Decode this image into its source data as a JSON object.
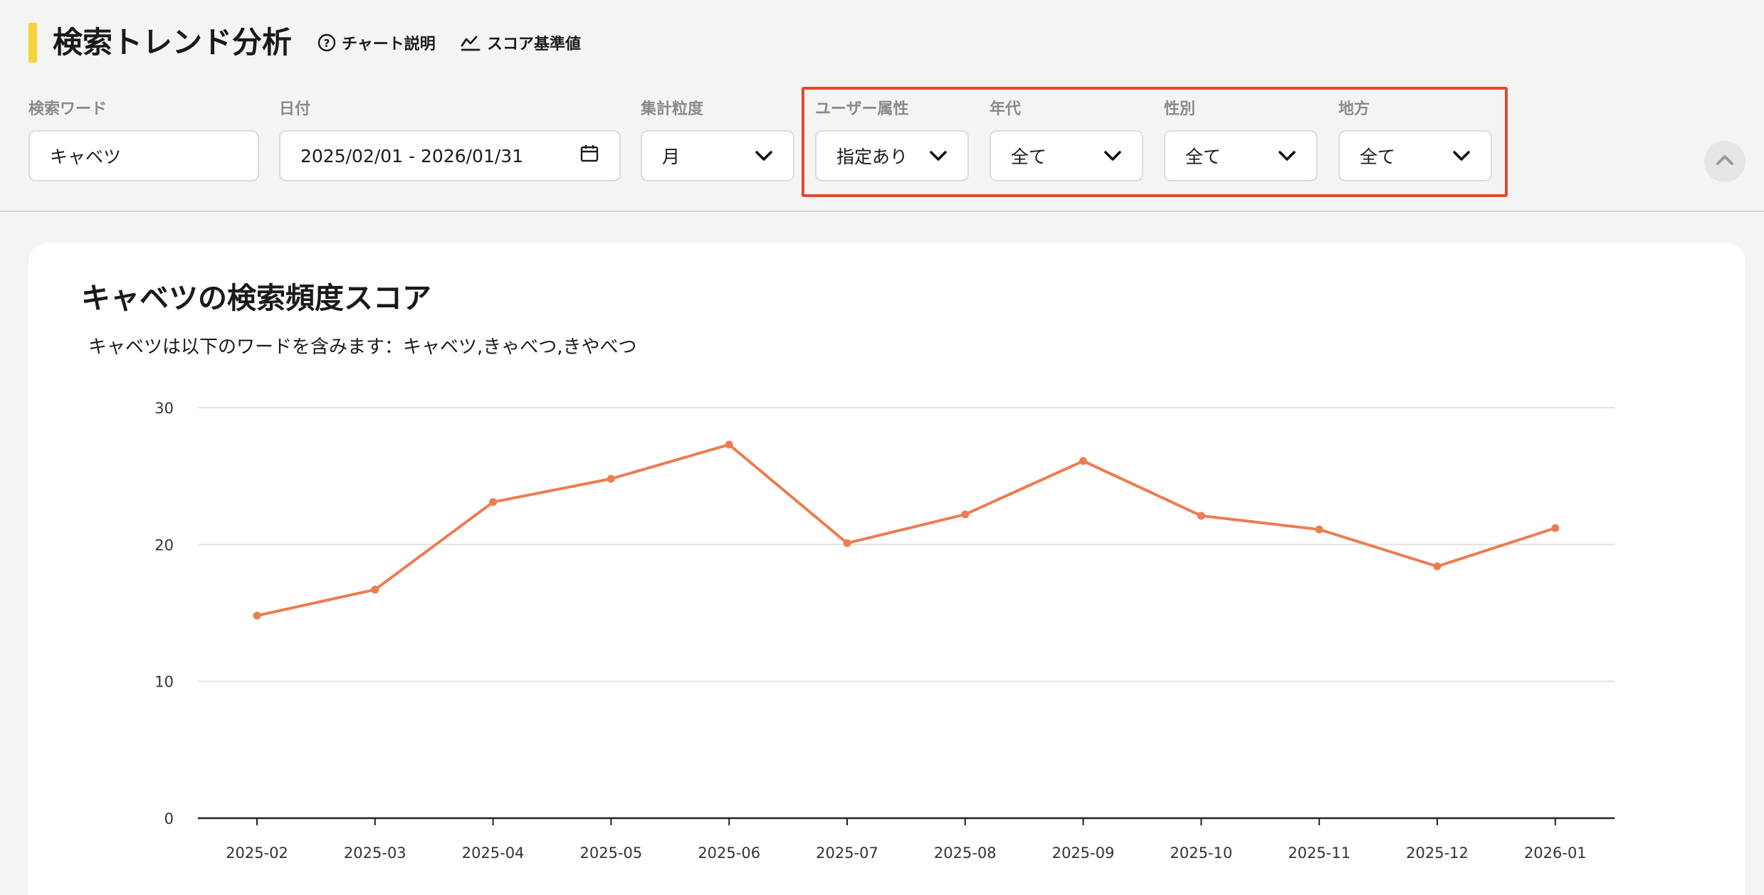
{
  "header": {
    "title": "検索トレンド分析",
    "chart_help_label": "チャート説明",
    "score_baseline_label": "スコア基準値"
  },
  "filters": {
    "keyword": {
      "label": "検索ワード",
      "value": "キャベツ"
    },
    "date": {
      "label": "日付",
      "value": "2025/02/01 - 2026/01/31"
    },
    "granularity": {
      "label": "集計粒度",
      "value": "月"
    },
    "user_attribute": {
      "label": "ユーザー属性",
      "value": "指定あり"
    },
    "age": {
      "label": "年代",
      "value": "全て"
    },
    "gender": {
      "label": "性別",
      "value": "全て"
    },
    "region": {
      "label": "地方",
      "value": "全て"
    }
  },
  "chart": {
    "title": "キャベツの検索頻度スコア",
    "subtitle": "キャベツは以下のワードを含みます：キャベツ,きゃべつ,きやべつ"
  },
  "chart_data": {
    "type": "line",
    "x": [
      "2025-02",
      "2025-03",
      "2025-04",
      "2025-05",
      "2025-06",
      "2025-07",
      "2025-08",
      "2025-09",
      "2025-10",
      "2025-11",
      "2025-12",
      "2026-01"
    ],
    "y": [
      14.8,
      16.7,
      23.1,
      24.8,
      27.3,
      20.1,
      22.2,
      26.1,
      22.1,
      21.1,
      18.4,
      21.2
    ],
    "ylim": [
      0,
      30
    ],
    "yticks": [
      0,
      10,
      20,
      30
    ],
    "ytick_labels": [
      "0",
      "10",
      "20",
      "30"
    ],
    "grid": true,
    "color": "#eb7d52",
    "title": "キャベツの検索頻度スコア"
  },
  "colors": {
    "accent": "#f7d33c",
    "highlight": "#e04a2e",
    "line": "#eb7d52"
  }
}
